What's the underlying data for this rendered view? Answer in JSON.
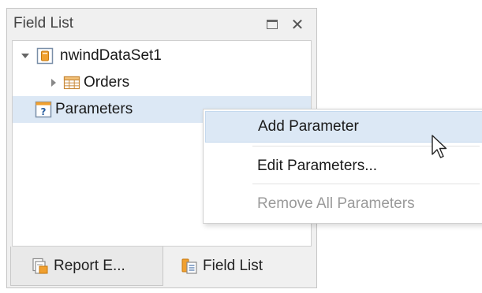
{
  "panel": {
    "title": "Field List",
    "restore_icon": "restore-icon",
    "close_icon": "close-icon",
    "close_glyph": "✕"
  },
  "tree": {
    "datasource": {
      "label": "nwindDataSet1",
      "icon": "datasource-icon",
      "expanded": true
    },
    "orders": {
      "label": "Orders",
      "icon": "table-icon",
      "expanded": false
    },
    "parameters": {
      "label": "Parameters",
      "icon": "parameters-icon",
      "selected": true
    }
  },
  "tabs": [
    {
      "label": "Report E...",
      "icon": "report-explorer-icon",
      "active": true
    },
    {
      "label": "Field List",
      "icon": "field-list-icon",
      "active": false
    }
  ],
  "context_menu": {
    "items": [
      {
        "label": "Add Parameter",
        "highlighted": true,
        "enabled": true
      },
      {
        "label": "Edit Parameters...",
        "highlighted": false,
        "enabled": true
      },
      {
        "label": "Remove All Parameters",
        "highlighted": false,
        "enabled": false
      }
    ]
  },
  "colors": {
    "selection": "#dce8f5",
    "disabled_text": "#9a9a9a",
    "accent_orange": "#f0a030",
    "panel_bg": "#f0f0f0"
  }
}
